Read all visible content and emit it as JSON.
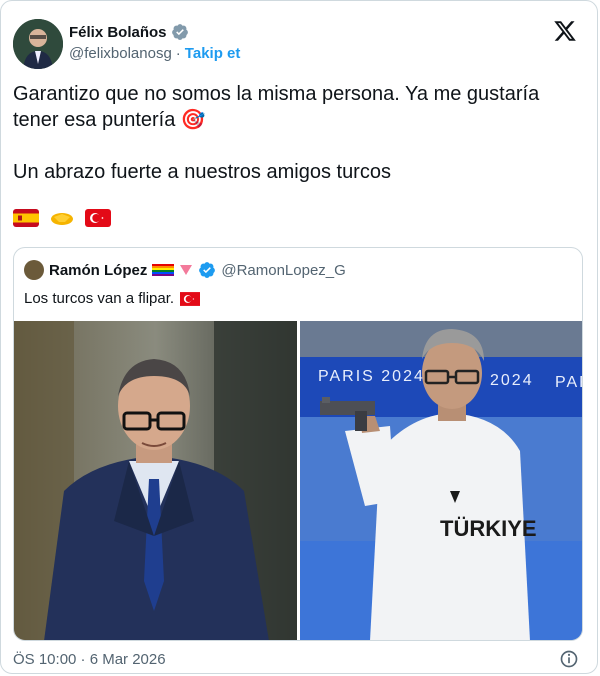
{
  "author": {
    "name": "Félix Bolaños",
    "handle": "@felixbolanosg",
    "separator": "·",
    "follow_label": "Takip et"
  },
  "tweet": {
    "text": "Garantizo que no somos la misma persona. Ya me gustaría tener esa puntería 🎯\n\nUn abrazo fuerte a nuestros amigos turcos",
    "emojis": [
      "flag-spain",
      "handshake",
      "flag-turkey"
    ]
  },
  "quoted": {
    "name": "Ramón López",
    "handle": "@RamonLopez_G",
    "text": "Los turcos van a flipar.",
    "images": {
      "left_desc": "man-in-suit",
      "right_banner_1": "PARIS 2024",
      "right_banner_2": "2024",
      "right_banner_3": "PAR",
      "shirt_text": "TÜRKIYE"
    }
  },
  "footer": {
    "timestamp": "ÖS 10:00 · 6 Mar 2026"
  },
  "colors": {
    "accent": "#1d9bf0",
    "verified": "#1d9bf0"
  }
}
